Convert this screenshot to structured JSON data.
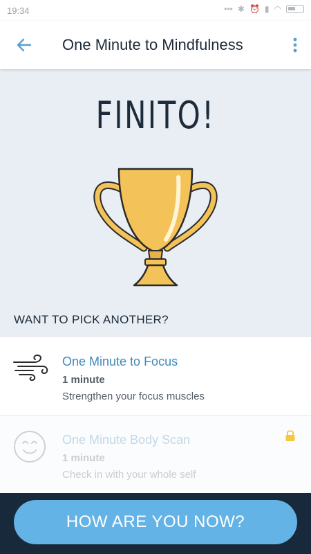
{
  "status_bar": {
    "time": "19:34"
  },
  "header": {
    "title": "One Minute to Mindfulness",
    "back_icon": "arrow-left-icon",
    "more_icon": "more-vertical-icon"
  },
  "main": {
    "headline": "FINITO!",
    "trophy_icon": "trophy-icon",
    "section_label": "WANT TO PICK ANOTHER?",
    "items": [
      {
        "title": "One Minute to Focus",
        "duration": "1 minute",
        "description": "Strengthen your focus muscles",
        "icon": "wind-icon",
        "locked": false
      },
      {
        "title": "One Minute Body Scan",
        "duration": "1 minute",
        "description": "Check in with your whole self",
        "icon": "smiley-face-icon",
        "locked": true
      }
    ]
  },
  "cta": {
    "label": "HOW ARE YOU NOW?"
  },
  "colors": {
    "accent": "#63b3e6",
    "title_blue": "#3d8ab8",
    "background": "#e8eef3",
    "bottom_bar": "#18293b",
    "trophy_gold": "#f3c35a",
    "lock": "#f5c842"
  }
}
